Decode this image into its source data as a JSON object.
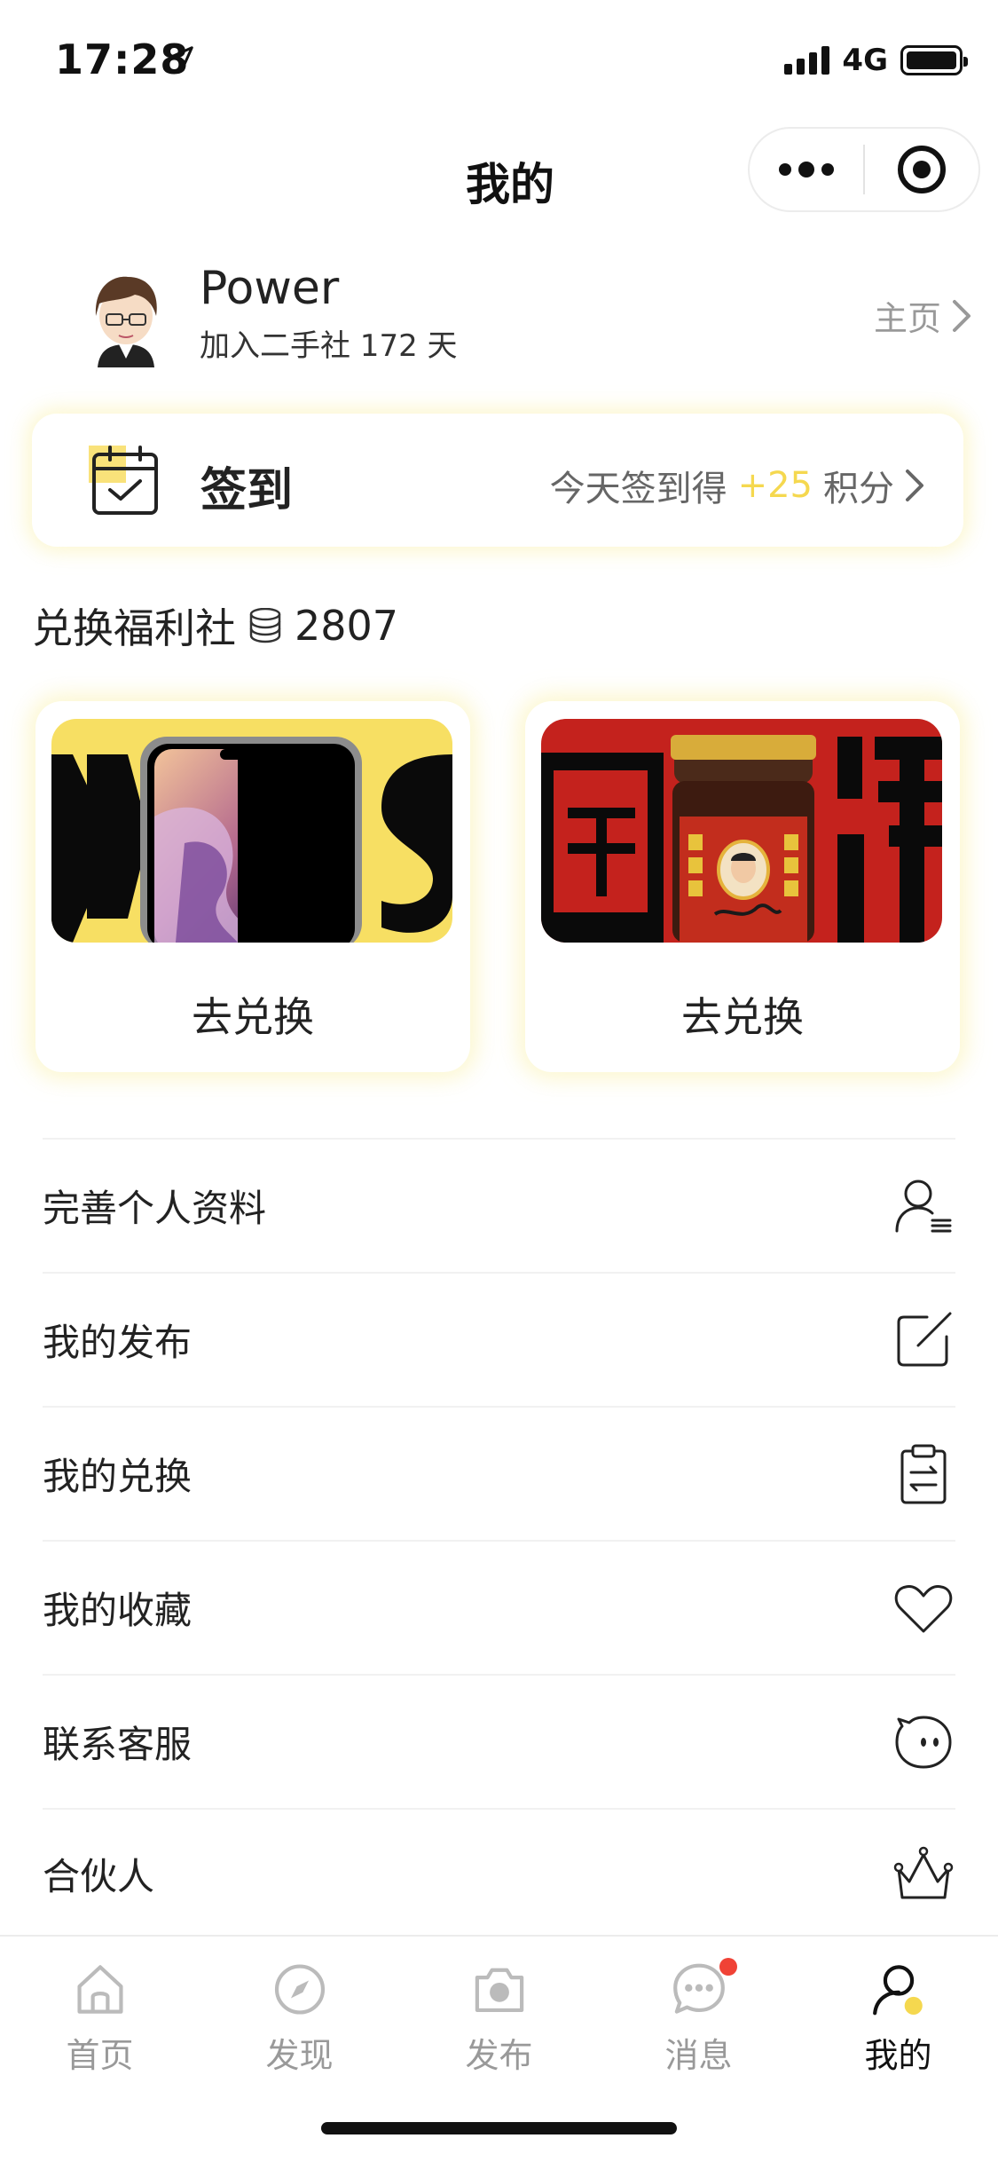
{
  "status_bar": {
    "time": "17:28",
    "network": "4G"
  },
  "header": {
    "title": "我的"
  },
  "profile": {
    "name": "Power",
    "days_text": "加入二手社 172 天",
    "home_link": "主页"
  },
  "checkin": {
    "label": "签到",
    "hint_prefix": "今天签到得",
    "points": "+25",
    "hint_suffix": "积分"
  },
  "exchange": {
    "title": "兑换福利社",
    "balance": "2807",
    "cards": [
      {
        "image_name": "iphone-xs-image",
        "button": "去兑换"
      },
      {
        "image_name": "chili-sauce-image",
        "button": "去兑换"
      }
    ]
  },
  "menu": {
    "items": [
      {
        "label": "完善个人资料",
        "icon": "user-profile-icon"
      },
      {
        "label": "我的发布",
        "icon": "edit-icon"
      },
      {
        "label": "我的兑换",
        "icon": "clipboard-exchange-icon"
      },
      {
        "label": "我的收藏",
        "icon": "heart-icon"
      },
      {
        "label": "联系客服",
        "icon": "service-face-icon"
      },
      {
        "label": "合伙人",
        "icon": "crown-icon"
      }
    ]
  },
  "tabs": [
    {
      "label": "首页",
      "icon": "home-icon",
      "active": false
    },
    {
      "label": "发现",
      "icon": "compass-icon",
      "active": false
    },
    {
      "label": "发布",
      "icon": "camera-icon",
      "active": false
    },
    {
      "label": "消息",
      "icon": "message-icon",
      "active": false,
      "badge": true
    },
    {
      "label": "我的",
      "icon": "profile-icon",
      "active": true
    }
  ],
  "colors": {
    "accent_yellow": "#f5d84f",
    "badge_red": "#f04236",
    "tab_inactive": "#999999",
    "tab_active": "#111111",
    "chili_red": "#c4221d"
  }
}
